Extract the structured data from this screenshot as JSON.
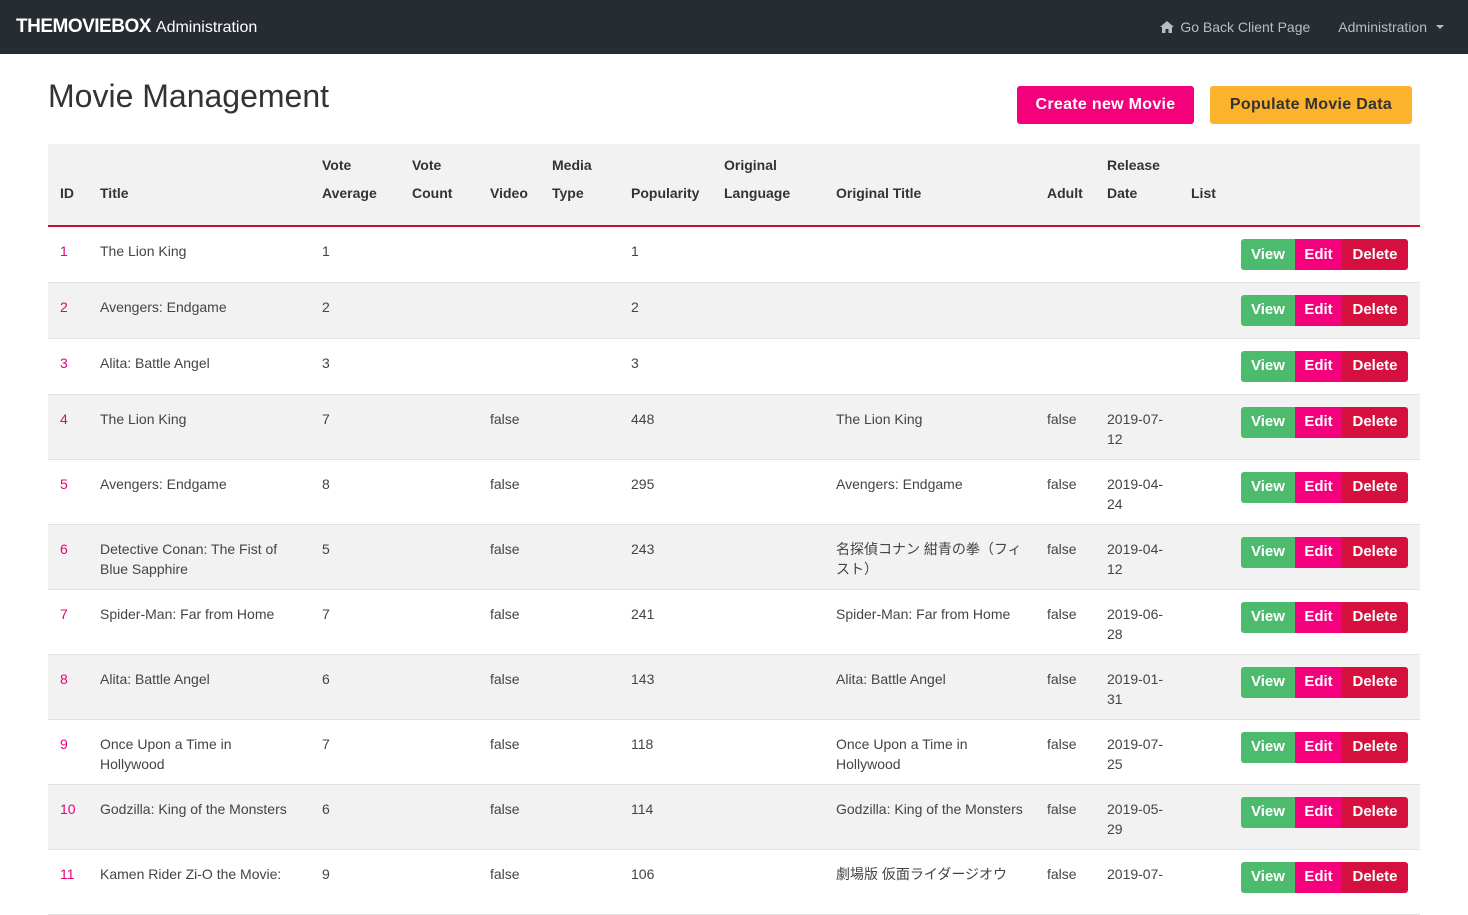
{
  "navbar": {
    "brand": "THEMOVIEBOX",
    "brand_sub": "Administration",
    "back_link": "Go Back Client Page",
    "admin_menu": "Administration"
  },
  "page": {
    "title": "Movie Management",
    "create_label": "Create new Movie",
    "populate_label": "Populate Movie Data"
  },
  "table": {
    "headers": [
      {
        "l1": "",
        "l2": "ID"
      },
      {
        "l1": "",
        "l2": "Title"
      },
      {
        "l1": "Vote",
        "l2": "Average"
      },
      {
        "l1": "Vote",
        "l2": "Count"
      },
      {
        "l1": "",
        "l2": "Video"
      },
      {
        "l1": "Media",
        "l2": "Type"
      },
      {
        "l1": "",
        "l2": "Popularity"
      },
      {
        "l1": "Original",
        "l2": "Language"
      },
      {
        "l1": "",
        "l2": "Original Title"
      },
      {
        "l1": "",
        "l2": "Adult"
      },
      {
        "l1": "Release",
        "l2": "Date"
      },
      {
        "l1": "",
        "l2": "List"
      },
      {
        "l1": "",
        "l2": ""
      }
    ],
    "action_labels": {
      "view": "View",
      "edit": "Edit",
      "delete": "Delete"
    },
    "rows": [
      {
        "id": "1",
        "title": "The Lion King",
        "vote_average": "1",
        "vote_count": "",
        "video": "",
        "media_type": "",
        "popularity": "1",
        "original_language": "",
        "original_title": "",
        "adult": "",
        "release_date": "",
        "list": ""
      },
      {
        "id": "2",
        "title": "Avengers: Endgame",
        "vote_average": "2",
        "vote_count": "",
        "video": "",
        "media_type": "",
        "popularity": "2",
        "original_language": "",
        "original_title": "",
        "adult": "",
        "release_date": "",
        "list": ""
      },
      {
        "id": "3",
        "title": "Alita: Battle Angel",
        "vote_average": "3",
        "vote_count": "",
        "video": "",
        "media_type": "",
        "popularity": "3",
        "original_language": "",
        "original_title": "",
        "adult": "",
        "release_date": "",
        "list": ""
      },
      {
        "id": "4",
        "title": "The Lion King",
        "vote_average": "7",
        "vote_count": "",
        "video": "false",
        "media_type": "",
        "popularity": "448",
        "original_language": "",
        "original_title": "The Lion King",
        "adult": "false",
        "release_date": "2019-07-12",
        "list": ""
      },
      {
        "id": "5",
        "title": "Avengers: Endgame",
        "vote_average": "8",
        "vote_count": "",
        "video": "false",
        "media_type": "",
        "popularity": "295",
        "original_language": "",
        "original_title": "Avengers: Endgame",
        "adult": "false",
        "release_date": "2019-04-24",
        "list": ""
      },
      {
        "id": "6",
        "title": "Detective Conan: The Fist of Blue Sapphire",
        "vote_average": "5",
        "vote_count": "",
        "video": "false",
        "media_type": "",
        "popularity": "243",
        "original_language": "",
        "original_title": "名探偵コナン 紺青の拳（フィスト）",
        "adult": "false",
        "release_date": "2019-04-12",
        "list": ""
      },
      {
        "id": "7",
        "title": "Spider-Man: Far from Home",
        "vote_average": "7",
        "vote_count": "",
        "video": "false",
        "media_type": "",
        "popularity": "241",
        "original_language": "",
        "original_title": "Spider-Man: Far from Home",
        "adult": "false",
        "release_date": "2019-06-28",
        "list": ""
      },
      {
        "id": "8",
        "title": "Alita: Battle Angel",
        "vote_average": "6",
        "vote_count": "",
        "video": "false",
        "media_type": "",
        "popularity": "143",
        "original_language": "",
        "original_title": "Alita: Battle Angel",
        "adult": "false",
        "release_date": "2019-01-31",
        "list": ""
      },
      {
        "id": "9",
        "title": "Once Upon a Time in Hollywood",
        "vote_average": "7",
        "vote_count": "",
        "video": "false",
        "media_type": "",
        "popularity": "118",
        "original_language": "",
        "original_title": "Once Upon a Time in Hollywood",
        "adult": "false",
        "release_date": "2019-07-25",
        "list": ""
      },
      {
        "id": "10",
        "title": "Godzilla: King of the Monsters",
        "vote_average": "6",
        "vote_count": "",
        "video": "false",
        "media_type": "",
        "popularity": "114",
        "original_language": "",
        "original_title": "Godzilla: King of the Monsters",
        "adult": "false",
        "release_date": "2019-05-29",
        "list": ""
      },
      {
        "id": "11",
        "title": "Kamen Rider Zi-O the Movie:",
        "vote_average": "9",
        "vote_count": "",
        "video": "false",
        "media_type": "",
        "popularity": "106",
        "original_language": "",
        "original_title": "劇場版 仮面ライダージオウ",
        "adult": "false",
        "release_date": "2019-07-",
        "list": ""
      }
    ]
  }
}
